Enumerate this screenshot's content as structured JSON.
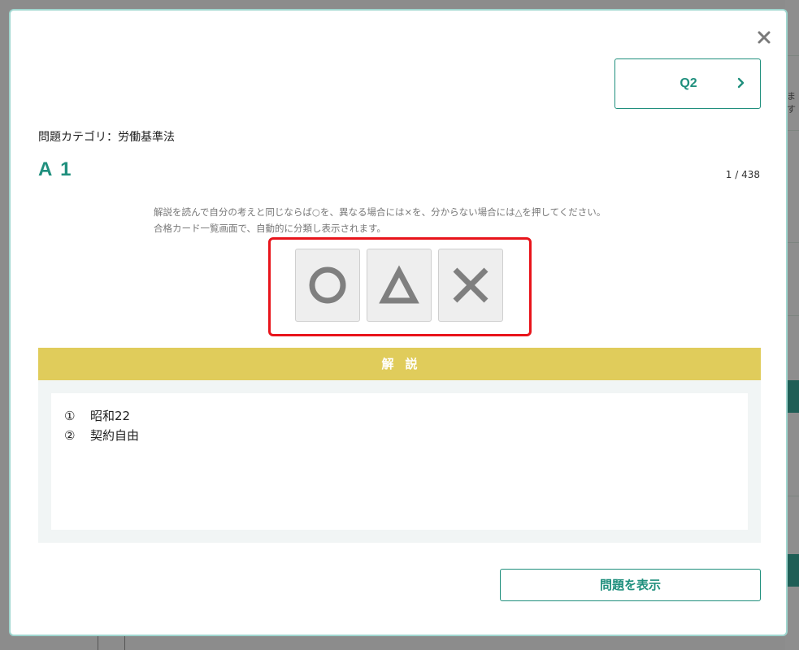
{
  "background": {
    "side_text": "ます"
  },
  "modal": {
    "next_button": {
      "label": "Q2"
    },
    "category": "問題カテゴリ：労働基準法",
    "answer_title": "A 1",
    "counter": "1 / 438",
    "instruction_lines": [
      "解説を読んで自分の考えと同じならば○を、異なる場合には×を、分からない場合には△を押してください。",
      "合格カード一覧画面で、自動的に分類し表示されます。"
    ],
    "marks": [
      {
        "name": "circle",
        "icon": "circle-icon"
      },
      {
        "name": "triangle",
        "icon": "triangle-icon"
      },
      {
        "name": "cross",
        "icon": "cross-icon"
      }
    ],
    "section_header": "解説",
    "explanation": [
      {
        "num": "①",
        "text": "昭和22"
      },
      {
        "num": "②",
        "text": "契約自由"
      }
    ],
    "show_question_label": "問題を表示"
  },
  "colors": {
    "accent": "#1f8f7d",
    "section_header": "#e0cc5b",
    "highlight": "#e8141b",
    "mark_icon": "#7f7f7f"
  }
}
